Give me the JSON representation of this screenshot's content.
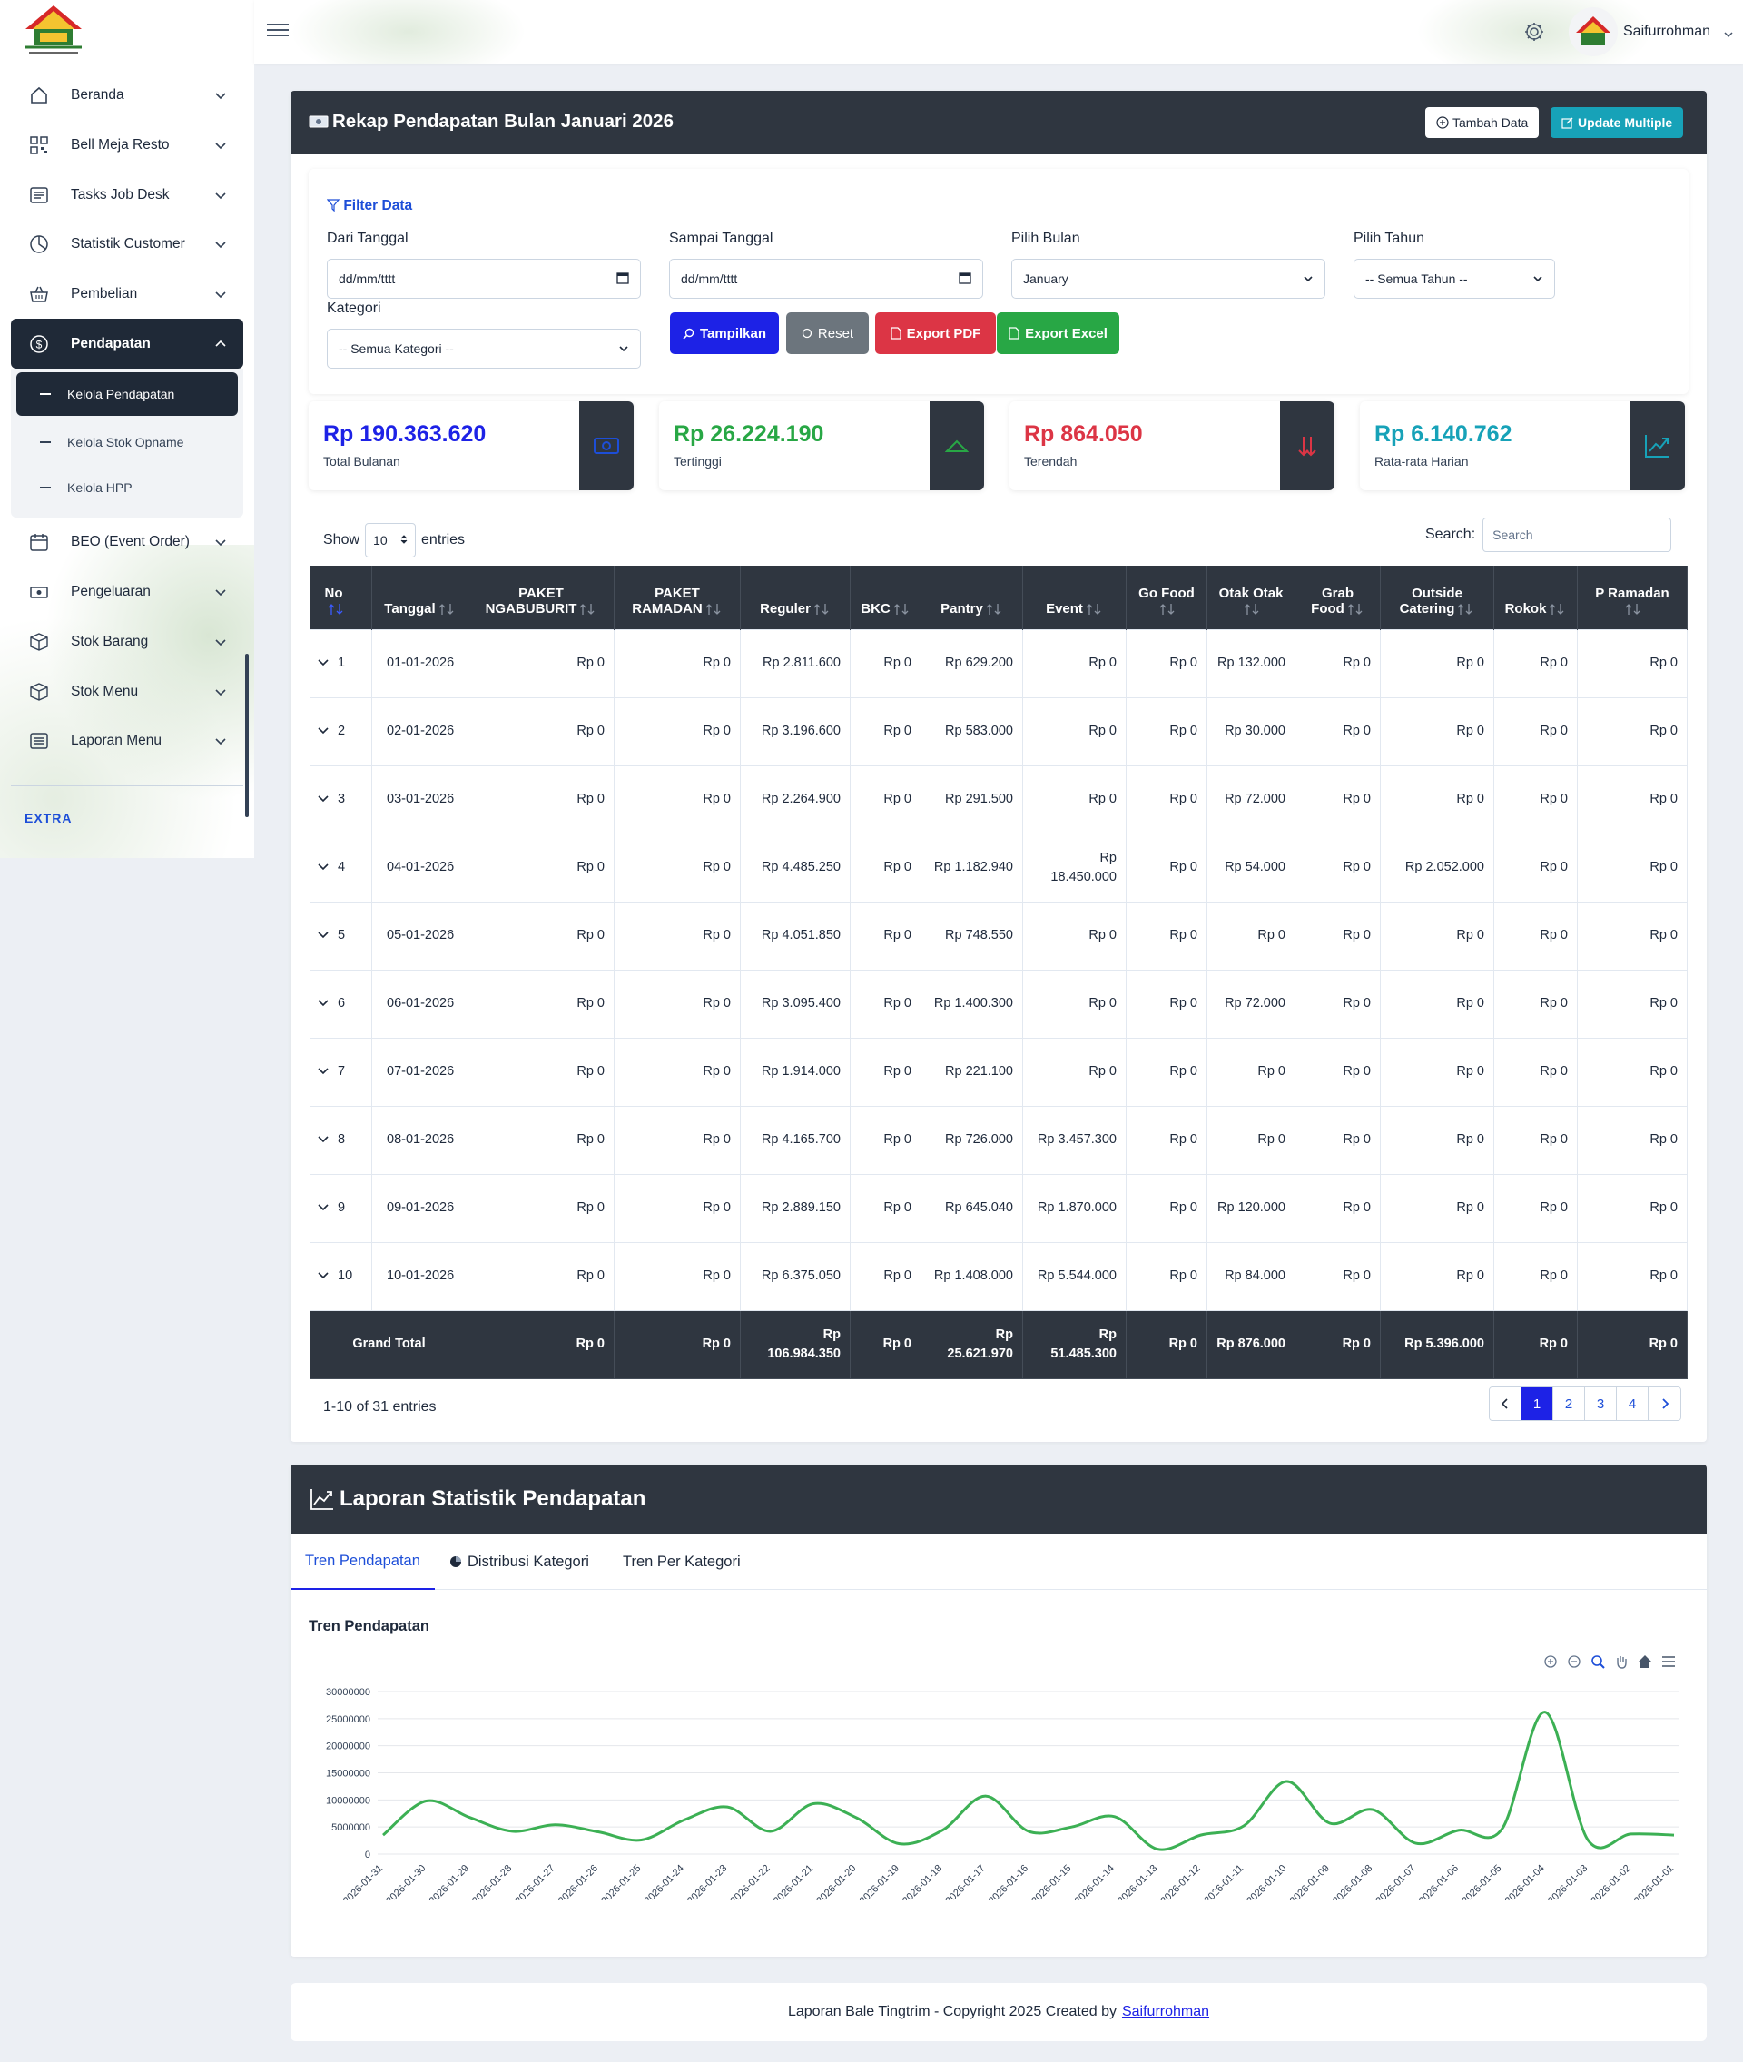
{
  "user": {
    "name": "Saifurrohman"
  },
  "sidebar": {
    "items": [
      {
        "label": "Beranda",
        "icon": "home-icon"
      },
      {
        "label": "Bell Meja Resto",
        "icon": "qr-icon"
      },
      {
        "label": "Tasks Job Desk",
        "icon": "list-icon"
      },
      {
        "label": "Statistik Customer",
        "icon": "pie-icon"
      },
      {
        "label": "Pembelian",
        "icon": "basket-icon"
      },
      {
        "label": "Pendapatan",
        "icon": "dollar-icon"
      }
    ],
    "submenu": [
      "Kelola Pendapatan",
      "Kelola Stok Opname",
      "Kelola HPP"
    ],
    "items2": [
      {
        "label": "BEO (Event Order)",
        "icon": "calendar-icon"
      },
      {
        "label": "Pengeluaran",
        "icon": "cash-icon"
      },
      {
        "label": "Stok Barang",
        "icon": "box-icon"
      },
      {
        "label": "Stok Menu",
        "icon": "box-icon"
      },
      {
        "label": "Laporan Menu",
        "icon": "report-icon"
      }
    ],
    "extra_label": "EXTRA"
  },
  "header": {
    "title": "Rekap Pendapatan Bulan Januari 2026",
    "tambah_label": "Tambah Data",
    "update_label": "Update Multiple"
  },
  "filter": {
    "title": "Filter Data",
    "dari_label": "Dari Tanggal",
    "dari_placeholder": "dd/mm/tttt",
    "sampai_label": "Sampai Tanggal",
    "sampai_placeholder": "dd/mm/tttt",
    "bulan_label": "Pilih Bulan",
    "bulan_value": "January",
    "tahun_label": "Pilih Tahun",
    "tahun_value": "-- Semua Tahun --",
    "kategori_label": "Kategori",
    "kategori_value": "-- Semua Kategori --",
    "btn_tampilkan": "Tampilkan",
    "btn_reset": "Reset",
    "btn_pdf": "Export PDF",
    "btn_excel": "Export Excel"
  },
  "stats": [
    {
      "value": "Rp 190.363.620",
      "label": "Total Bulanan",
      "color": "#1d22e6",
      "icon": "money-icon"
    },
    {
      "value": "Rp 26.224.190",
      "label": "Tertinggi",
      "color": "#28a745",
      "icon": "arrow-up-icon"
    },
    {
      "value": "Rp 864.050",
      "label": "Terendah",
      "color": "#dc3545",
      "icon": "arrows-down-icon"
    },
    {
      "value": "Rp 6.140.762",
      "label": "Rata-rata Harian",
      "color": "#17a2b8",
      "icon": "chart-up-icon"
    }
  ],
  "table_controls": {
    "show_label": "Show",
    "entries_value": "10",
    "entries_label": "entries",
    "search_label": "Search:",
    "search_placeholder": "Search"
  },
  "table": {
    "headers": [
      "No",
      "Tanggal",
      "PAKET NGABUBURIT",
      "PAKET RAMADAN",
      "Reguler",
      "BKC",
      "Pantry",
      "Event",
      "Go Food",
      "Otak Otak",
      "Grab Food",
      "Outside Catering",
      "Rokok",
      "P Ramadan"
    ],
    "rows": [
      [
        "1",
        "01-01-2026",
        "Rp 0",
        "Rp 0",
        "Rp 2.811.600",
        "Rp 0",
        "Rp 629.200",
        "Rp 0",
        "Rp 0",
        "Rp 132.000",
        "Rp 0",
        "Rp 0",
        "Rp 0",
        "Rp 0"
      ],
      [
        "2",
        "02-01-2026",
        "Rp 0",
        "Rp 0",
        "Rp 3.196.600",
        "Rp 0",
        "Rp 583.000",
        "Rp 0",
        "Rp 0",
        "Rp 30.000",
        "Rp 0",
        "Rp 0",
        "Rp 0",
        "Rp 0"
      ],
      [
        "3",
        "03-01-2026",
        "Rp 0",
        "Rp 0",
        "Rp 2.264.900",
        "Rp 0",
        "Rp 291.500",
        "Rp 0",
        "Rp 0",
        "Rp 72.000",
        "Rp 0",
        "Rp 0",
        "Rp 0",
        "Rp 0"
      ],
      [
        "4",
        "04-01-2026",
        "Rp 0",
        "Rp 0",
        "Rp 4.485.250",
        "Rp 0",
        "Rp 1.182.940",
        "Rp 18.450.000",
        "Rp 0",
        "Rp 54.000",
        "Rp 0",
        "Rp 2.052.000",
        "Rp 0",
        "Rp 0"
      ],
      [
        "5",
        "05-01-2026",
        "Rp 0",
        "Rp 0",
        "Rp 4.051.850",
        "Rp 0",
        "Rp 748.550",
        "Rp 0",
        "Rp 0",
        "Rp 0",
        "Rp 0",
        "Rp 0",
        "Rp 0",
        "Rp 0"
      ],
      [
        "6",
        "06-01-2026",
        "Rp 0",
        "Rp 0",
        "Rp 3.095.400",
        "Rp 0",
        "Rp 1.400.300",
        "Rp 0",
        "Rp 0",
        "Rp 72.000",
        "Rp 0",
        "Rp 0",
        "Rp 0",
        "Rp 0"
      ],
      [
        "7",
        "07-01-2026",
        "Rp 0",
        "Rp 0",
        "Rp 1.914.000",
        "Rp 0",
        "Rp 221.100",
        "Rp 0",
        "Rp 0",
        "Rp 0",
        "Rp 0",
        "Rp 0",
        "Rp 0",
        "Rp 0"
      ],
      [
        "8",
        "08-01-2026",
        "Rp 0",
        "Rp 0",
        "Rp 4.165.700",
        "Rp 0",
        "Rp 726.000",
        "Rp 3.457.300",
        "Rp 0",
        "Rp 0",
        "Rp 0",
        "Rp 0",
        "Rp 0",
        "Rp 0"
      ],
      [
        "9",
        "09-01-2026",
        "Rp 0",
        "Rp 0",
        "Rp 2.889.150",
        "Rp 0",
        "Rp 645.040",
        "Rp 1.870.000",
        "Rp 0",
        "Rp 120.000",
        "Rp 0",
        "Rp 0",
        "Rp 0",
        "Rp 0"
      ],
      [
        "10",
        "10-01-2026",
        "Rp 0",
        "Rp 0",
        "Rp 6.375.050",
        "Rp 0",
        "Rp 1.408.000",
        "Rp 5.544.000",
        "Rp 0",
        "Rp 84.000",
        "Rp 0",
        "Rp 0",
        "Rp 0",
        "Rp 0"
      ]
    ],
    "total": [
      "Grand Total",
      "Rp 0",
      "Rp 0",
      "Rp 106.984.350",
      "Rp 0",
      "Rp 25.621.970",
      "Rp 51.485.300",
      "Rp 0",
      "Rp 876.000",
      "Rp 0",
      "Rp 5.396.000",
      "Rp 0",
      "Rp 0"
    ]
  },
  "pagination": {
    "info": "1-10 of 31 entries",
    "pages": [
      "1",
      "2",
      "3",
      "4"
    ],
    "current": "1"
  },
  "stats_card": {
    "title": "Laporan Statistik Pendapatan",
    "tabs": [
      "Tren Pendapatan",
      "Distribusi Kategori",
      "Tren Per Kategori"
    ],
    "active_tab": "Tren Pendapatan"
  },
  "chart_data": {
    "type": "line",
    "title": "Tren Pendapatan",
    "xlabel": "",
    "ylabel": "",
    "ylim": [
      0,
      30000000
    ],
    "yticks": [
      "0",
      "5000000",
      "10000000",
      "15000000",
      "20000000",
      "25000000",
      "30000000"
    ],
    "x": [
      "2026-01-31",
      "2026-01-30",
      "2026-01-29",
      "2026-01-28",
      "2026-01-27",
      "2026-01-26",
      "2026-01-25",
      "2026-01-24",
      "2026-01-23",
      "2026-01-22",
      "2026-01-21",
      "2026-01-20",
      "2026-01-19",
      "2026-01-18",
      "2026-01-17",
      "2026-01-16",
      "2026-01-15",
      "2026-01-14",
      "2026-01-13",
      "2026-01-12",
      "2026-01-11",
      "2026-01-10",
      "2026-01-09",
      "2026-01-08",
      "2026-01-07",
      "2026-01-06",
      "2026-01-05",
      "2026-01-04",
      "2026-01-03",
      "2026-01-02",
      "2026-01-01"
    ],
    "series": [
      {
        "values": [
          3500000,
          9800000,
          6800000,
          4200000,
          5400000,
          4100000,
          2600000,
          6300000,
          8700000,
          4200000,
          9300000,
          6700000,
          1900000,
          4400000,
          10700000,
          4200000,
          5000000,
          6900000,
          900000,
          3500000,
          5200000,
          13400000,
          5700000,
          8200000,
          2000000,
          4400000,
          4600000,
          26200000,
          2600000,
          3700000,
          3500000
        ]
      }
    ],
    "color": "#3cb054",
    "grid": true
  },
  "footer": {
    "text": "Laporan Bale Tingtrim - Copyright 2025 Created by",
    "link": "Saifurrohman"
  }
}
